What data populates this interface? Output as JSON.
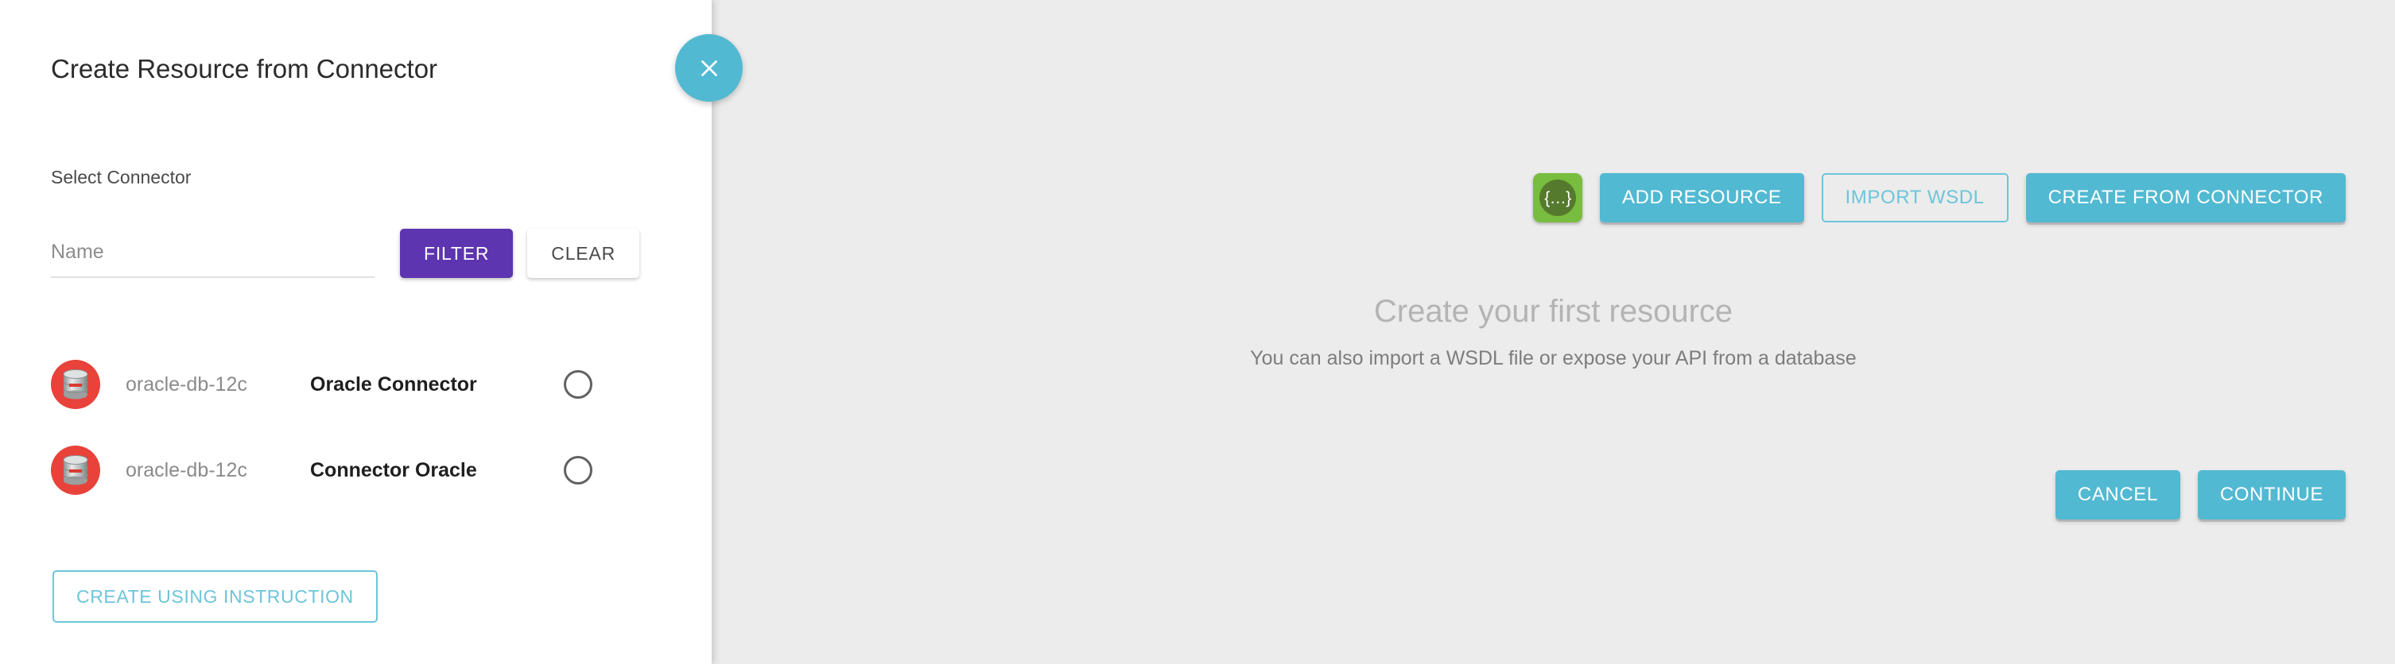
{
  "drawer": {
    "title": "Create Resource from Connector",
    "section_label": "Select Connector",
    "filter": {
      "name_placeholder": "Name",
      "name_value": "",
      "filter_label": "FILTER",
      "clear_label": "CLEAR",
      "filter_color": "#5e35b1"
    },
    "connectors": [
      {
        "id": "oracle-db-12c",
        "name": "Oracle Connector",
        "icon": "database-icon",
        "icon_color": "#e8423a",
        "selected": false
      },
      {
        "id": "oracle-db-12c",
        "name": "Connector Oracle",
        "icon": "database-icon",
        "icon_color": "#e8423a",
        "selected": false
      }
    ],
    "create_using_instruction_label": "CREATE USING INSTRUCTION",
    "close_icon": "close-icon"
  },
  "workspace": {
    "background_color": "#ececec",
    "toolbar": {
      "json_icon": "{…}",
      "json_icon_name": "json-code-icon",
      "json_icon_color": "#78bd3f",
      "add_resource_label": "ADD RESOURCE",
      "import_wsdl_label": "IMPORT WSDL",
      "create_from_connector_label": "CREATE FROM CONNECTOR",
      "accent_color": "#52b9d2"
    },
    "empty_state": {
      "title": "Create your first resource",
      "subtitle": "You can also import a WSDL file or expose your API from a database"
    },
    "footer": {
      "cancel_label": "CANCEL",
      "continue_label": "CONTINUE"
    }
  }
}
